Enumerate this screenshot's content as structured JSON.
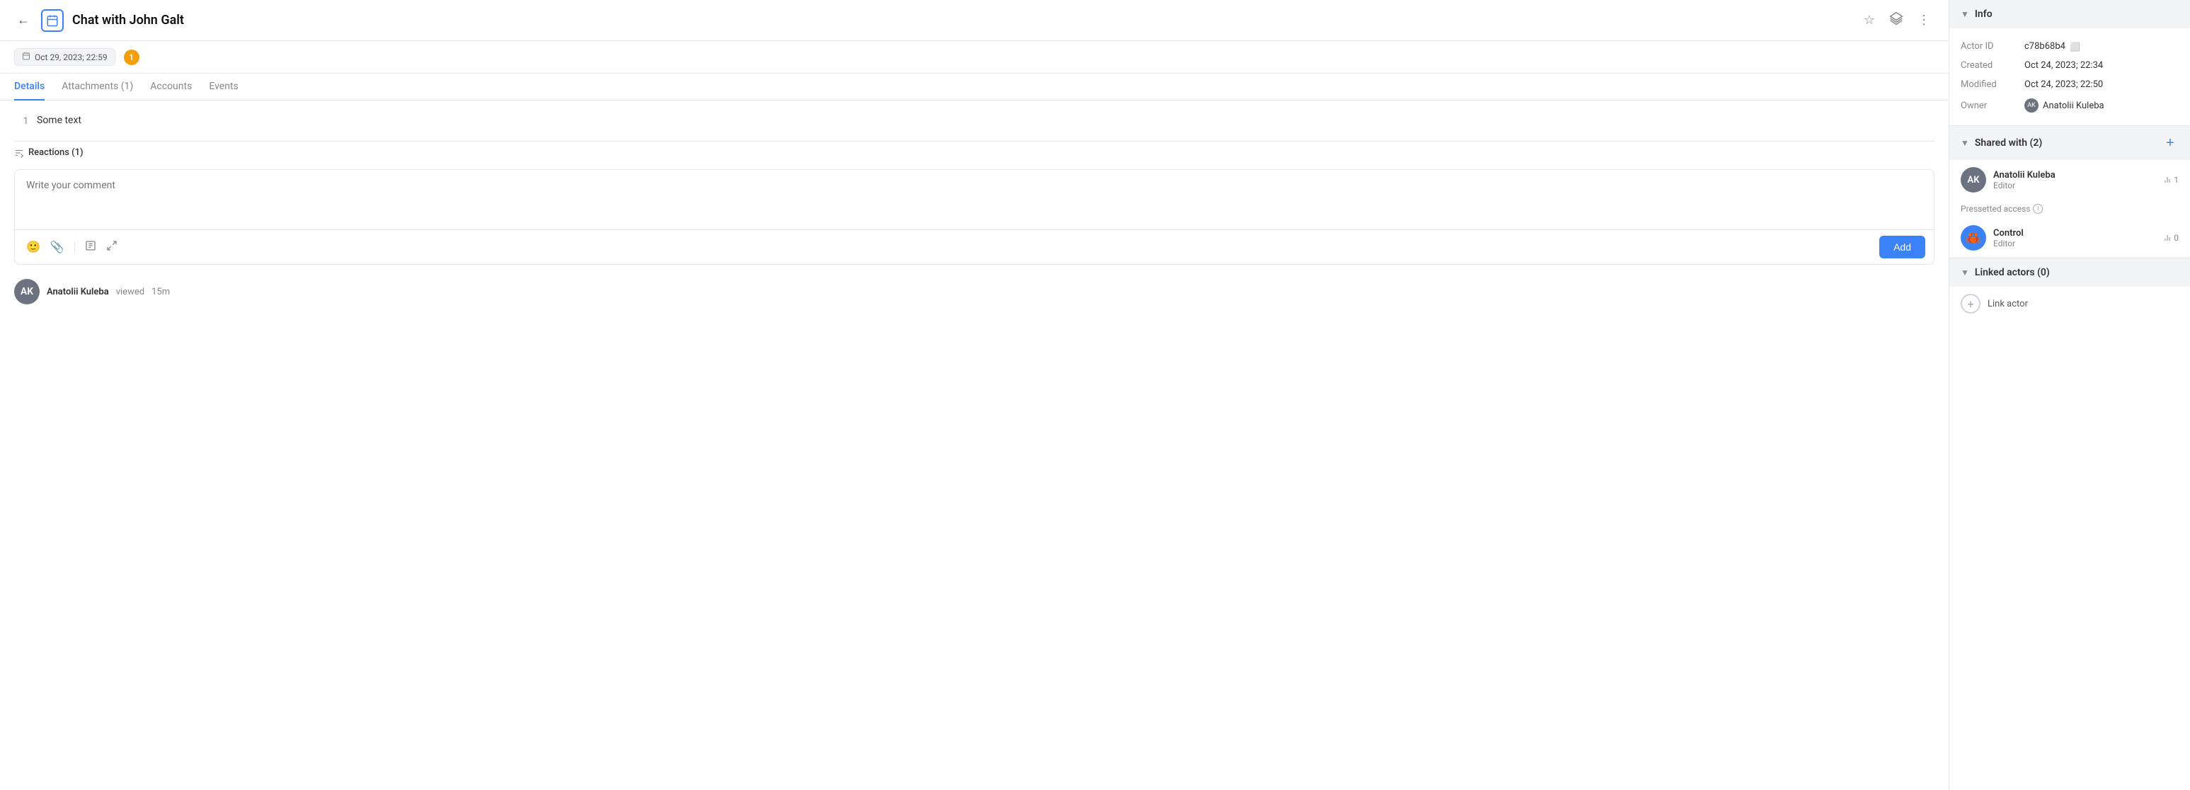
{
  "header": {
    "back_label": "←",
    "title": "Chat with John Galt",
    "icon_label": "📅",
    "star_label": "☆",
    "layers_label": "⬡",
    "more_label": "⋮"
  },
  "subheader": {
    "date": "Oct 29, 2023; 22:59",
    "count": "1"
  },
  "tabs": [
    {
      "id": "details",
      "label": "Details",
      "active": true
    },
    {
      "id": "attachments",
      "label": "Attachments (1)",
      "active": false
    },
    {
      "id": "accounts",
      "label": "Accounts",
      "active": false
    },
    {
      "id": "events",
      "label": "Events",
      "active": false
    }
  ],
  "messages": [
    {
      "number": "1",
      "text": "Some text"
    }
  ],
  "reactions": {
    "label": "Reactions (1)"
  },
  "comment": {
    "placeholder": "Write your comment",
    "add_button": "Add"
  },
  "viewer": {
    "name": "Anatolii Kuleba",
    "action": "viewed",
    "time": "15m"
  },
  "info_panel": {
    "info_section_label": "Info",
    "actor_id_label": "Actor ID",
    "actor_id_value": "c78b68b4",
    "created_label": "Created",
    "created_value": "Oct 24, 2023; 22:34",
    "modified_label": "Modified",
    "modified_value": "Oct 24, 2023; 22:50",
    "owner_label": "Owner",
    "owner_value": "Anatolii Kuleba",
    "shared_section_label": "Shared with (2)",
    "shared_users": [
      {
        "name": "Anatolii Kuleba",
        "role": "Editor",
        "stat": "1"
      }
    ],
    "presett_label": "Pressetted access",
    "control_users": [
      {
        "name": "Control",
        "role": "Editor",
        "stat": "0"
      }
    ],
    "linked_section_label": "Linked actors (0)",
    "link_actor_label": "Link actor"
  }
}
